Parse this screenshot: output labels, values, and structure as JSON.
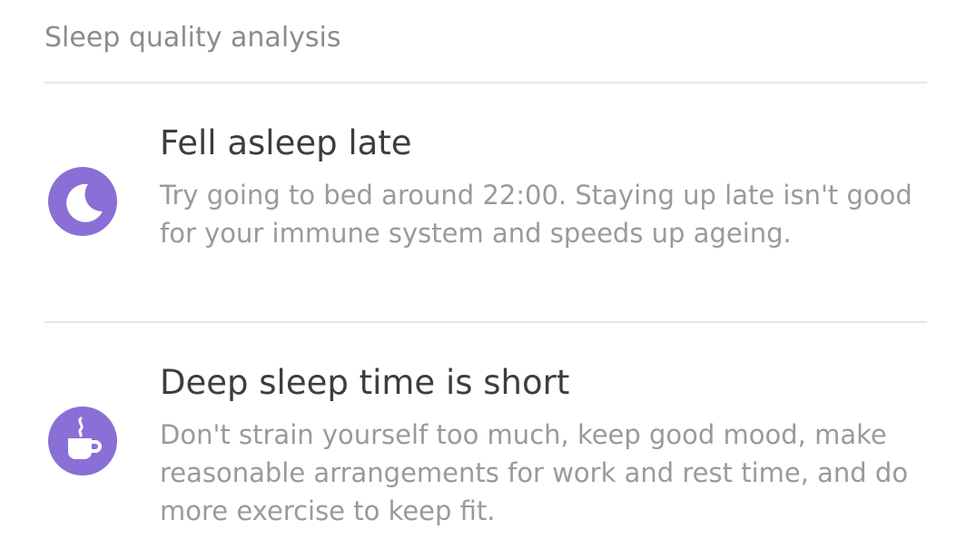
{
  "section": {
    "title": "Sleep quality analysis"
  },
  "items": [
    {
      "icon": "moon-icon",
      "title": "Fell asleep late",
      "description": "Try going to bed around 22:00. Staying up late isn't good for your immune system and speeds up ageing."
    },
    {
      "icon": "coffee-cup-icon",
      "title": "Deep sleep time is short",
      "description": "Don't strain yourself too much, keep good mood, make reasonable arrangements for work and rest time, and do more exercise to keep fit."
    }
  ],
  "colors": {
    "accent": "#8a6fd6",
    "title_text": "#3d3d3d",
    "secondary_text": "#9a9a9a",
    "section_text": "#8c8c8c",
    "divider": "#e6e6e6"
  }
}
